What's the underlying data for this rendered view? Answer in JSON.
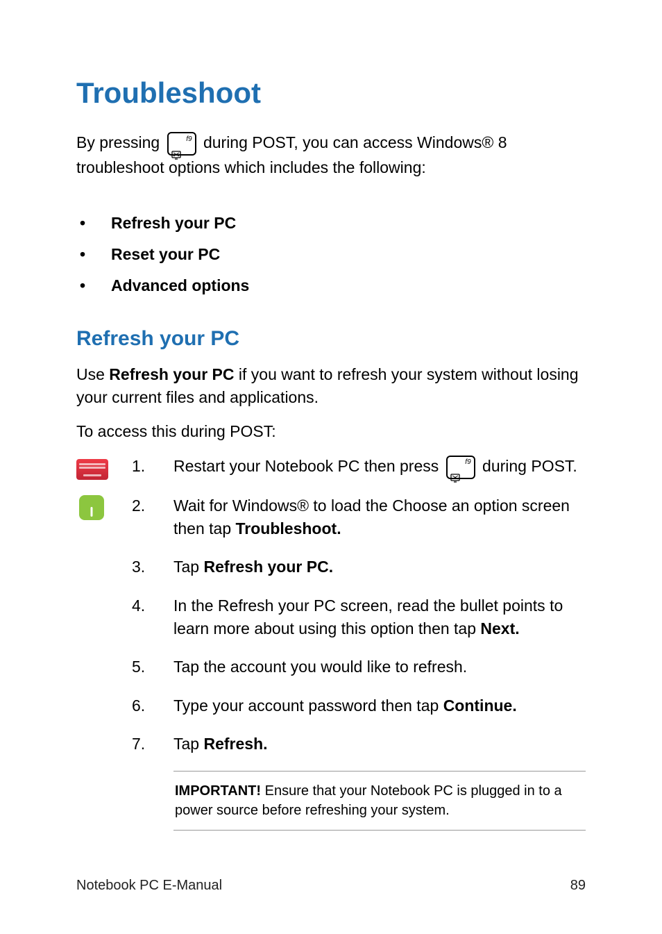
{
  "title": "Troubleshoot",
  "intro_before_key": "By pressing ",
  "intro_after_key": " during POST, you can access Windows® 8 troubleshoot options which includes the following:",
  "key_label": "f9",
  "bullets": [
    "Refresh your PC",
    "Reset your PC",
    "Advanced options"
  ],
  "section_title": "Refresh your PC",
  "section_intro_prefix": "Use ",
  "section_intro_bold": "Refresh your PC",
  "section_intro_suffix": " if you want to refresh your system without losing your current files and applications.",
  "lead": "To access this during POST:",
  "steps": [
    {
      "num": "1.",
      "before": "Restart your Notebook PC then press ",
      "after": " during POST.",
      "has_key": true
    },
    {
      "num": "2.",
      "before": "Wait for Windows® to load the Choose an option screen then tap ",
      "bold": "Troubleshoot.",
      "after": ""
    },
    {
      "num": "3.",
      "before": "Tap ",
      "bold": "Refresh your PC.",
      "after": ""
    },
    {
      "num": "4.",
      "before": "In the Refresh your PC screen, read the bullet points to learn more about using this option then tap ",
      "bold": "Next.",
      "after": ""
    },
    {
      "num": "5.",
      "before": "Tap the account you would like to refresh.",
      "bold": "",
      "after": ""
    },
    {
      "num": "6.",
      "before": "Type your account password then tap ",
      "bold": "Continue.",
      "after": ""
    },
    {
      "num": "7.",
      "before": "Tap ",
      "bold": "Refresh.",
      "after": ""
    }
  ],
  "note_bold": "IMPORTANT!",
  "note_text": " Ensure that your Notebook PC is plugged in to a power source before refreshing your system.",
  "footer_left": "Notebook PC E-Manual",
  "footer_right": "89"
}
